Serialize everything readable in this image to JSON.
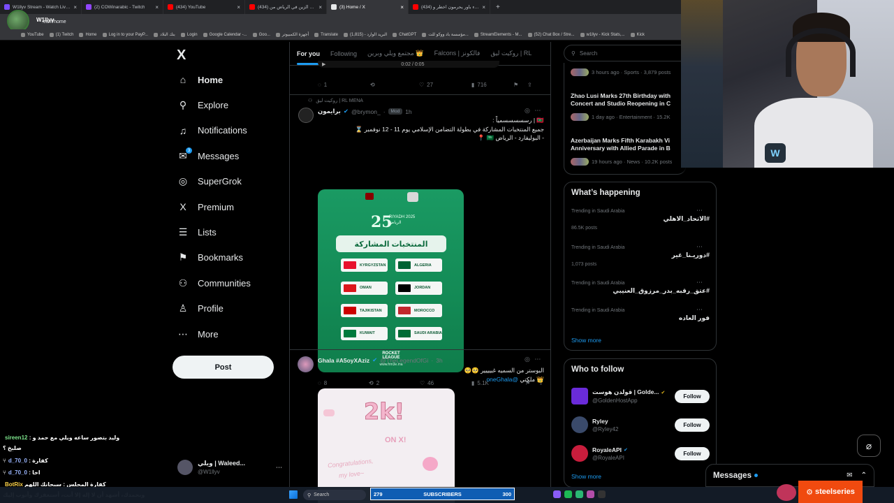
{
  "browser": {
    "tabs": [
      {
        "label": "W1llyv Stream - Watch Live on",
        "color": "#7a4dff"
      },
      {
        "label": "(2) COWinarabic - Twitch",
        "color": "#9146ff"
      },
      {
        "label": "(434) YouTube",
        "color": "#ff0000"
      },
      {
        "label": "(434) تحدي الزين في الرياض من",
        "color": "#ff0000"
      },
      {
        "label": "(3) Home / X",
        "color": "#e7e9ea",
        "active": true
      },
      {
        "label": "(434) اعضاء باور يحرمون اخطر و",
        "color": "#ff0000"
      }
    ],
    "new_tab": "+",
    "url": ".com/home",
    "streamer_name": "W1llyv",
    "bookmarks": [
      "YouTube",
      "(1) Twitch",
      "Home",
      "Log in to your PayP...",
      "بنك البلاد",
      "Login",
      "Google Calendar -...",
      "Goo...",
      "أجهزة الكمبيوتر",
      "Translate",
      "البريد الوارد - (1,815)",
      "ChatGPT",
      "مؤسسة باد ووكو للت...",
      "StreamElements - M...",
      "(52) Chat Box / Stre...",
      "w1llyv - Kick Stats,...",
      "Kick"
    ]
  },
  "sidebar": {
    "logo": "X",
    "items": [
      {
        "label": "Home",
        "icon": "⌂",
        "bold": true
      },
      {
        "label": "Explore",
        "icon": "⚲"
      },
      {
        "label": "Notifications",
        "icon": "♫"
      },
      {
        "label": "Messages",
        "icon": "✉",
        "badge": "3"
      },
      {
        "label": "SuperGrok",
        "icon": "◎"
      },
      {
        "label": "Premium",
        "icon": "X"
      },
      {
        "label": "Lists",
        "icon": "☰"
      },
      {
        "label": "Bookmarks",
        "icon": "⚑"
      },
      {
        "label": "Communities",
        "icon": "⚇"
      },
      {
        "label": "Profile",
        "icon": "♙"
      },
      {
        "label": "More",
        "icon": "⋯"
      }
    ],
    "post_label": "Post",
    "account": {
      "name": "ويلي | Waleed...",
      "handle": "@W1llyv"
    }
  },
  "timeline": {
    "tabs": [
      "For you",
      "Following",
      "مجتمع ويلي وبرين 👑",
      "Falcons | فالكونز",
      "روكيت ليق | RL"
    ],
    "prev_post": {
      "video_time": "0:02 / 0:05",
      "replies": "1",
      "reposts": "",
      "likes": "27",
      "views": "716"
    },
    "post1": {
      "community": "روكيت ليق | RL MENA",
      "name": "برايمون",
      "handle": "@brymon_",
      "badge": "Mod",
      "time": "1h",
      "line1": "🇲🇻 | رسسسسسمياً :",
      "line2": "جميع المنتخبات المشاركة في بطولة التضامن الإسلامي يوم 11 - 12 نوفمبر ⌛",
      "line3": "- البوليفارد - الرياض 🇸🇦 📍",
      "image": {
        "event": "RIYADH 2025 الرياض",
        "number": "25",
        "heading": "المنتخبات المشاركة",
        "teams": [
          "KYRGYZSTAN",
          "ALGERIA",
          "OMAN",
          "JORDAN",
          "TAJIKISTAN",
          "MOROCCO",
          "KUWAIT",
          "SAUDI ARABIA"
        ],
        "team_colors": [
          "#e8112d",
          "#006233",
          "#db161b",
          "#000000",
          "#cc0000",
          "#c1272d",
          "#007a3d",
          "#006c35"
        ],
        "brand": "ROCKET LEAGUE",
        "site": "www.frm3e.ma"
      },
      "replies": "8",
      "reposts": "2",
      "likes": "46",
      "views": "5.1K"
    },
    "post2": {
      "name": "Ghala #A5oyXAziz",
      "handle": "@TheLegendOfGi",
      "time": "3h",
      "line1": "البوستر من السميه غبيييير 🥺🥺",
      "mention": "@oneGhala",
      "line2": "👑 ملكتي",
      "image_text": "2k!",
      "image_sub": "ON X!",
      "image_congrats": "Congratulations,",
      "image_love": "my love~"
    }
  },
  "right": {
    "search_placeholder": "Search",
    "news": [
      {
        "title": "",
        "meta": "3 hours ago · Sports · 3,879 posts"
      },
      {
        "title": "Zhao Lusi Marks 27th Birthday with Concert and Studio Reopening in C",
        "meta": "1 day ago · Entertainment · 15.2K"
      },
      {
        "title": "Azerbaijan Marks Fifth Karabakh Vi Anniversary with Allied Parade in B",
        "meta": "19 hours ago · News · 10.2K posts"
      }
    ],
    "happening": {
      "title": "What’s happening",
      "trends": [
        {
          "context": "Trending in Saudi Arabia",
          "name": "#الاتحاد_الاهلي",
          "posts": "86.5K posts"
        },
        {
          "context": "Trending in Saudi Arabia",
          "name": "#دوريـنا_غير",
          "posts": "1,073 posts"
        },
        {
          "context": "Trending in Saudi Arabia",
          "name": "#عتق_رقبه_بدر_مرزوق_العنيبي",
          "posts": ""
        },
        {
          "context": "Trending in Saudi Arabia",
          "name": "فور العاده",
          "posts": ""
        }
      ],
      "show_more": "Show more"
    },
    "who_to_follow": {
      "title": "Who to follow",
      "accounts": [
        {
          "name": "قولدن هوست | Golde...",
          "handle": "@GoldenHostApp",
          "verified": true,
          "color": "#6a2bd9"
        },
        {
          "name": "Ryley",
          "handle": "@RyIey42",
          "verified": false,
          "color": "#3a4a6a"
        },
        {
          "name": "RoyaleAPI",
          "handle": "@RoyaleAPI",
          "verified": true,
          "color": "#c81d3c"
        }
      ],
      "follow_label": "Follow",
      "show_more": "Show more"
    },
    "messages_label": "Messages"
  },
  "chat": [
    {
      "user": "sireen12",
      "text": "وليد بتصور ساعه ويلي مع حمد و :",
      "color": "#7ce38b"
    },
    {
      "user": "",
      "text": "صلبخ ؟",
      "color": "#ffffff"
    },
    {
      "user": "d_70_0",
      "text": "كفارة :",
      "color": "#9ab6ff"
    },
    {
      "user": "d_70_0",
      "text": "اخا :",
      "color": "#9ab6ff"
    },
    {
      "user": "BotRix",
      "text": "كفارة المجلس : سبحانك اللهم",
      "color": "#ffd54a"
    },
    {
      "user": "",
      "text": "وبحمدك، أشهد أن لا إله إلا أنت، أستغفرك وأتوب إليك",
      "color": "#ffffff"
    }
  ],
  "taskbar": {
    "search": "Search",
    "subs_current": "279",
    "subs_label": "SUBSCRIBERS",
    "subs_goal": "300",
    "brand": "steelseries"
  }
}
